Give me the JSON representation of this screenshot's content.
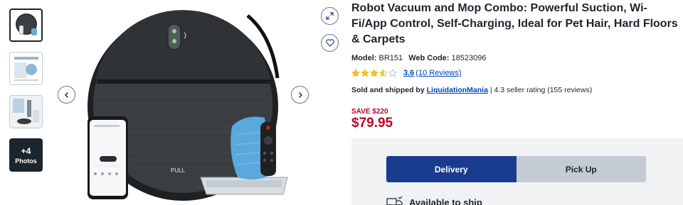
{
  "thumbnails": {
    "more_count": "+4",
    "more_label": "Photos"
  },
  "icons": {
    "expand": "expand-icon",
    "favorite": "heart-icon",
    "prev": "chevron-left-icon",
    "next": "chevron-right-icon",
    "star": "star-icon",
    "truck": "delivery-truck-icon"
  },
  "product": {
    "title": "Robot Vacuum and Mop Combo: Powerful Suction, Wi-Fi/App Control, Self-Charging, Ideal for Pet Hair, Hard Floors & Carpets",
    "model_label": "Model:",
    "model_value": "BR151",
    "webcode_label": "Web Code:",
    "webcode_value": "18523096",
    "rating_value": "3.6",
    "rating_fraction": 0.72,
    "reviews_link": "(10 Reviews)",
    "seller_prefix": "Sold and shipped by",
    "seller_name": "LiquidationMania",
    "seller_rating": " | 4.3 seller rating (155 reviews)",
    "save_text": "SAVE $220",
    "price": "$79.95",
    "image_label": "PULL"
  },
  "fulfillment": {
    "delivery_label": "Delivery",
    "pickup_label": "Pick Up",
    "availability_text": "Available to ship"
  },
  "colors": {
    "price_red": "#bb0628",
    "link_blue": "#0046be",
    "delivery_blue": "#1a3c8f",
    "star_gold": "#ffc500"
  }
}
